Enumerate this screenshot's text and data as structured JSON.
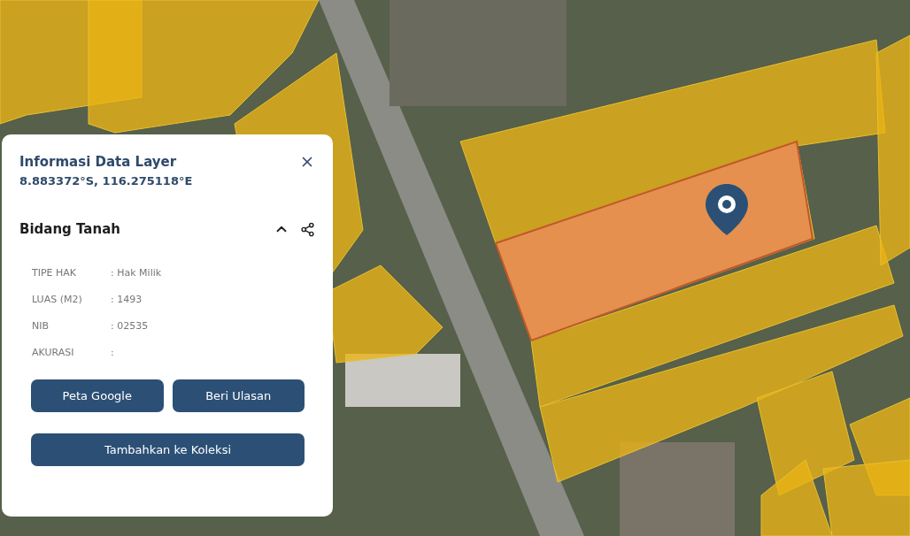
{
  "info_panel": {
    "title": "Informasi Data Layer",
    "coordinates": "8.883372°S, 116.275118°E",
    "section": {
      "title": "Bidang Tanah",
      "expanded": true,
      "attributes": [
        {
          "label": "TIPE HAK",
          "value": ": Hak Milik"
        },
        {
          "label": "LUAS (M2)",
          "value": ": 1493"
        },
        {
          "label": "NIB",
          "value": ": 02535"
        },
        {
          "label": "AKURASI",
          "value": ":"
        }
      ]
    },
    "buttons": [
      {
        "label": "Peta Google",
        "kind": "half"
      },
      {
        "label": "Beri Ulasan",
        "kind": "half"
      },
      {
        "label": "Tambahkan ke Koleksi",
        "kind": "full"
      }
    ]
  }
}
